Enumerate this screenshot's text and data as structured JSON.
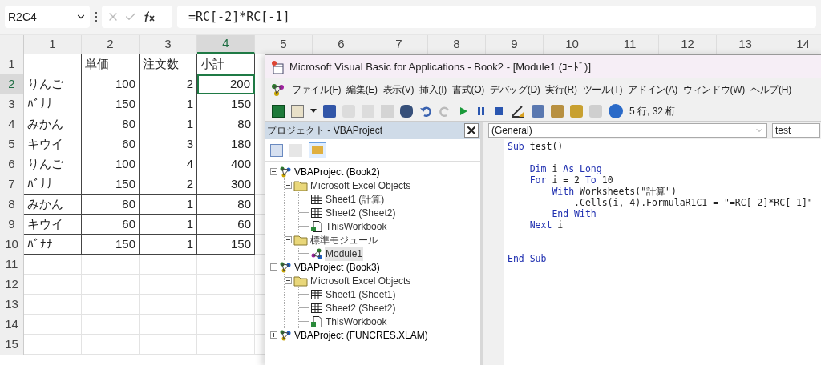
{
  "formula_bar": {
    "name_box": "R2C4",
    "formula": "=RC[-2]*RC[-1]"
  },
  "sheet": {
    "columns": [
      {
        "label": "1",
        "selected": false
      },
      {
        "label": "2",
        "selected": false
      },
      {
        "label": "3",
        "selected": false
      },
      {
        "label": "4",
        "selected": true
      },
      {
        "label": "5",
        "selected": false
      },
      {
        "label": "6",
        "selected": false
      },
      {
        "label": "7",
        "selected": false
      },
      {
        "label": "8",
        "selected": false
      },
      {
        "label": "9",
        "selected": false
      },
      {
        "label": "10",
        "selected": false
      },
      {
        "label": "11",
        "selected": false
      },
      {
        "label": "12",
        "selected": false
      },
      {
        "label": "13",
        "selected": false
      },
      {
        "label": "14",
        "selected": false
      }
    ],
    "rows": [
      {
        "header": "1",
        "selected": false,
        "kind": "header",
        "cells": [
          null,
          "単価",
          "注文数",
          "小計"
        ]
      },
      {
        "header": "2",
        "selected": true,
        "kind": "data",
        "cells": [
          "りんご",
          "100",
          "2",
          "200"
        ]
      },
      {
        "header": "3",
        "selected": false,
        "kind": "data",
        "cells": [
          "ﾊﾞﾅﾅ",
          "150",
          "1",
          "150"
        ]
      },
      {
        "header": "4",
        "selected": false,
        "kind": "data",
        "cells": [
          "みかん",
          "80",
          "1",
          "80"
        ]
      },
      {
        "header": "5",
        "selected": false,
        "kind": "data",
        "cells": [
          "キウイ",
          "60",
          "3",
          "180"
        ]
      },
      {
        "header": "6",
        "selected": false,
        "kind": "data",
        "cells": [
          "りんご",
          "100",
          "4",
          "400"
        ]
      },
      {
        "header": "7",
        "selected": false,
        "kind": "data",
        "cells": [
          "ﾊﾞﾅﾅ",
          "150",
          "2",
          "300"
        ]
      },
      {
        "header": "8",
        "selected": false,
        "kind": "data",
        "cells": [
          "みかん",
          "80",
          "1",
          "80"
        ]
      },
      {
        "header": "9",
        "selected": false,
        "kind": "data",
        "cells": [
          "キウイ",
          "60",
          "1",
          "60"
        ]
      },
      {
        "header": "10",
        "selected": false,
        "kind": "data",
        "cells": [
          "ﾊﾞﾅﾅ",
          "150",
          "1",
          "150"
        ]
      },
      {
        "header": "11",
        "selected": false,
        "kind": "empty"
      },
      {
        "header": "12",
        "selected": false,
        "kind": "empty"
      },
      {
        "header": "13",
        "selected": false,
        "kind": "empty"
      },
      {
        "header": "14",
        "selected": false,
        "kind": "empty"
      },
      {
        "header": "15",
        "selected": false,
        "kind": "empty"
      }
    ]
  },
  "vbe": {
    "title": "Microsoft Visual Basic for Applications - Book2 - [Module1 (ｺｰﾄﾞ)]",
    "menu": [
      "ファイル(F)",
      "編集(E)",
      "表示(V)",
      "挿入(I)",
      "書式(O)",
      "デバッグ(D)",
      "実行(R)",
      "ツール(T)",
      "アドイン(A)",
      "ウィンドウ(W)",
      "ヘルプ(H)"
    ],
    "position": "5 行, 32 桁",
    "project": {
      "title": "プロジェクト - VBAProject",
      "tree": [
        {
          "kind": "project",
          "label": "VBAProject (Book2)",
          "expanded": true,
          "selected": false,
          "children": [
            {
              "kind": "folder",
              "label": "Microsoft Excel Objects",
              "expanded": true,
              "selected": false,
              "children": [
                {
                  "kind": "sheet",
                  "label": "Sheet1 (計算)",
                  "selected": false
                },
                {
                  "kind": "sheet",
                  "label": "Sheet2 (Sheet2)",
                  "selected": false
                },
                {
                  "kind": "workbook",
                  "label": "ThisWorkbook",
                  "selected": false
                }
              ]
            },
            {
              "kind": "folder",
              "label": "標準モジュール",
              "expanded": true,
              "selected": false,
              "children": [
                {
                  "kind": "module",
                  "label": "Module1",
                  "selected": true
                }
              ]
            }
          ]
        },
        {
          "kind": "project",
          "label": "VBAProject (Book3)",
          "expanded": true,
          "selected": false,
          "children": [
            {
              "kind": "folder",
              "label": "Microsoft Excel Objects",
              "expanded": true,
              "selected": false,
              "children": [
                {
                  "kind": "sheet",
                  "label": "Sheet1 (Sheet1)",
                  "selected": false
                },
                {
                  "kind": "sheet",
                  "label": "Sheet2 (Sheet2)",
                  "selected": false
                },
                {
                  "kind": "workbook",
                  "label": "ThisWorkbook",
                  "selected": false
                }
              ]
            }
          ]
        },
        {
          "kind": "project",
          "label": "VBAProject (FUNCRES.XLAM)",
          "expanded": false,
          "selected": false
        }
      ]
    },
    "code": {
      "object": "(General)",
      "procedure": "test",
      "segments": [
        {
          "kind": "keyword",
          "text": "Sub"
        },
        {
          "kind": "text",
          "text": " test()\n\n"
        },
        {
          "kind": "keyword",
          "text": "    Dim"
        },
        {
          "kind": "text",
          "text": " i "
        },
        {
          "kind": "keyword",
          "text": "As Long\n"
        },
        {
          "kind": "keyword",
          "text": "    For"
        },
        {
          "kind": "text",
          "text": " i = 2 "
        },
        {
          "kind": "keyword",
          "text": "To"
        },
        {
          "kind": "text",
          "text": " 10\n"
        },
        {
          "kind": "keyword",
          "text": "        With"
        },
        {
          "kind": "text",
          "text": " Worksheets(\"計算\")"
        },
        {
          "kind": "caret"
        },
        {
          "kind": "text",
          "text": "\n            .Cells(i, 4).FormulaR1C1 = \"=RC[-2]*RC[-1]\"\n"
        },
        {
          "kind": "keyword",
          "text": "        End With\n"
        },
        {
          "kind": "keyword",
          "text": "    Next"
        },
        {
          "kind": "text",
          "text": " i\n\n\n"
        },
        {
          "kind": "keyword",
          "text": "End Sub"
        }
      ]
    }
  }
}
